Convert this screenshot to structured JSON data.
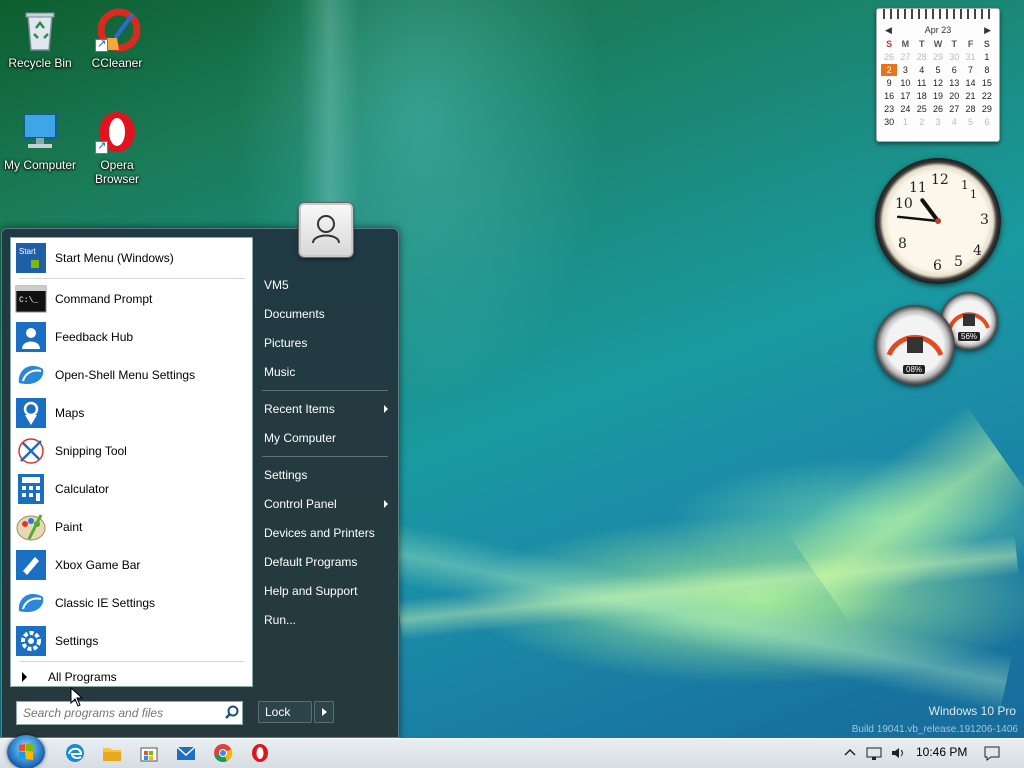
{
  "desktop": {
    "icons": [
      {
        "label": "Recycle Bin",
        "icon": "recycle-bin-icon"
      },
      {
        "label": "CCleaner",
        "icon": "ccleaner-icon"
      },
      {
        "label": "My Computer",
        "icon": "computer-icon"
      },
      {
        "label": "Opera Browser",
        "icon": "opera-icon"
      }
    ],
    "watermark_line1": "Windows 10 Pro",
    "watermark_line2": "Build 19041.vb_release.191206-1406"
  },
  "gadgets": {
    "calendar": {
      "month": "Apr 23",
      "headers": [
        "S",
        "M",
        "T",
        "W",
        "T",
        "F",
        "S"
      ],
      "weeks": [
        [
          "26",
          "27",
          "28",
          "29",
          "30",
          "31",
          "1"
        ],
        [
          "2",
          "3",
          "4",
          "5",
          "6",
          "7",
          "8"
        ],
        [
          "9",
          "10",
          "11",
          "12",
          "13",
          "14",
          "15"
        ],
        [
          "16",
          "17",
          "18",
          "19",
          "20",
          "21",
          "22"
        ],
        [
          "23",
          "24",
          "25",
          "26",
          "27",
          "28",
          "29"
        ],
        [
          "30",
          "1",
          "2",
          "3",
          "4",
          "5",
          "6"
        ]
      ],
      "today": "2"
    },
    "clock": {
      "hour": 10,
      "minute": 46
    },
    "cpu_meter": {
      "cpu": "08%",
      "ram": "56%",
      "cpu_value": 8,
      "ram_value": 56
    }
  },
  "start_menu": {
    "programs": [
      {
        "label": "Start Menu (Windows)",
        "icon": "start-menu-icon"
      },
      {
        "label": "Command Prompt",
        "icon": "command-prompt-icon"
      },
      {
        "label": "Feedback Hub",
        "icon": "feedback-hub-icon"
      },
      {
        "label": "Open-Shell Menu Settings",
        "icon": "open-shell-icon"
      },
      {
        "label": "Maps",
        "icon": "maps-icon"
      },
      {
        "label": "Snipping Tool",
        "icon": "snipping-tool-icon"
      },
      {
        "label": "Calculator",
        "icon": "calculator-icon"
      },
      {
        "label": "Paint",
        "icon": "paint-icon"
      },
      {
        "label": "Xbox Game Bar",
        "icon": "xbox-game-bar-icon"
      },
      {
        "label": "Classic IE Settings",
        "icon": "classic-ie-icon"
      },
      {
        "label": "Settings",
        "icon": "settings-gear-icon"
      }
    ],
    "all_programs": "All Programs",
    "search_placeholder": "Search programs and files",
    "right_items": [
      {
        "label": "VM5",
        "submenu": false
      },
      {
        "label": "Documents",
        "submenu": false
      },
      {
        "label": "Pictures",
        "submenu": false
      },
      {
        "label": "Music",
        "submenu": false
      },
      {
        "label": "Recent Items",
        "submenu": true
      },
      {
        "label": "My Computer",
        "submenu": false
      },
      {
        "label": "Settings",
        "submenu": false
      },
      {
        "label": "Control Panel",
        "submenu": true
      },
      {
        "label": "Devices and Printers",
        "submenu": false
      },
      {
        "label": "Default Programs",
        "submenu": false
      },
      {
        "label": "Help and Support",
        "submenu": false
      },
      {
        "label": "Run...",
        "submenu": false
      }
    ],
    "lock_label": "Lock"
  },
  "taskbar": {
    "pinned": [
      "edge-icon",
      "file-explorer-icon",
      "store-icon",
      "mail-icon",
      "chrome-icon",
      "opera-icon"
    ],
    "time": "10:46 PM",
    "tray": [
      "show-hidden-icon",
      "network-icon",
      "volume-icon",
      "notification-icon"
    ]
  },
  "colors": {
    "accent": "#1c5da6",
    "menu_dark": "#243a40",
    "today_highlight": "#e8731a"
  }
}
